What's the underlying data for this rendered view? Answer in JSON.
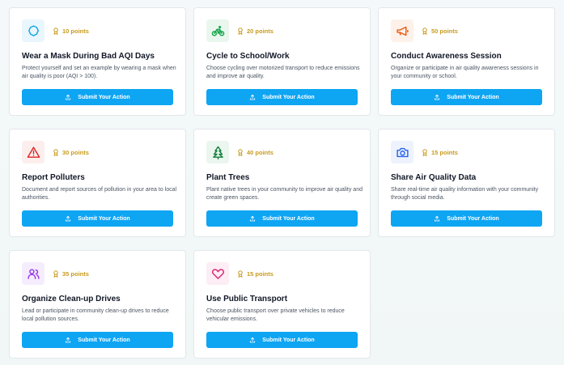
{
  "actions": [
    {
      "title": "Wear a Mask During Bad AQI Days",
      "points": "10 points",
      "description": "Protect yourself and set an example by wearing a mask when air quality is poor (AQI > 100).",
      "button": "Submit Your Action",
      "icon": "mask-icon",
      "icon_color": "#0ea5e9",
      "icon_bg": "#eaf6fd"
    },
    {
      "title": "Cycle to School/Work",
      "points": "20 points",
      "description": "Choose cycling over motorized transport to reduce emissions and improve air quality.",
      "button": "Submit Your Action",
      "icon": "bicycle-icon",
      "icon_color": "#16a34a",
      "icon_bg": "#eaf7ee"
    },
    {
      "title": "Conduct Awareness Session",
      "points": "50 points",
      "description": "Organize or participate in air quality awareness sessions in your community or school.",
      "button": "Submit Your Action",
      "icon": "megaphone-icon",
      "icon_color": "#ea580c",
      "icon_bg": "#fdf1ea"
    },
    {
      "title": "Report Polluters",
      "points": "30 points",
      "description": "Document and report sources of pollution in your area to local authorities.",
      "button": "Submit Your Action",
      "icon": "warning-icon",
      "icon_color": "#dc2626",
      "icon_bg": "#fdeeee"
    },
    {
      "title": "Plant Trees",
      "points": "40 points",
      "description": "Plant native trees in your community to improve air quality and create green spaces.",
      "button": "Submit Your Action",
      "icon": "tree-icon",
      "icon_color": "#15803d",
      "icon_bg": "#eaf6ee"
    },
    {
      "title": "Share Air Quality Data",
      "points": "15 points",
      "description": "Share real-time air quality information with your community through social media.",
      "button": "Submit Your Action",
      "icon": "camera-icon",
      "icon_color": "#2563eb",
      "icon_bg": "#edf2fd"
    },
    {
      "title": "Organize Clean-up Drives",
      "points": "35 points",
      "description": "Lead or participate in community clean-up drives to reduce local pollution sources.",
      "button": "Submit Your Action",
      "icon": "users-icon",
      "icon_color": "#9333ea",
      "icon_bg": "#f5edfd"
    },
    {
      "title": "Use Public Transport",
      "points": "15 points",
      "description": "Choose public transport over private vehicles to reduce vehicular emissions.",
      "button": "Submit Your Action",
      "icon": "heart-icon",
      "icon_color": "#db2777",
      "icon_bg": "#fdedf4"
    }
  ]
}
